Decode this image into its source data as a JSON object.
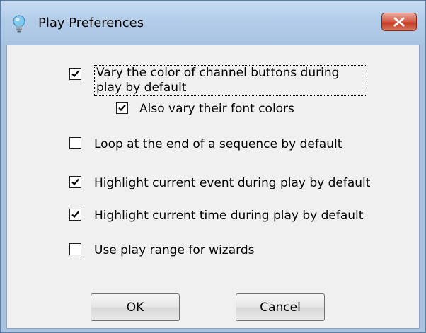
{
  "window": {
    "title": "Play Preferences",
    "close_icon": "close-icon"
  },
  "options": {
    "vary_color": {
      "label_line1": "Vary the color of channel buttons during",
      "label_line2": "play by default",
      "checked": true
    },
    "vary_font": {
      "label": "Also vary their font colors",
      "checked": true
    },
    "loop": {
      "label": "Loop at the end of a sequence by default",
      "checked": false
    },
    "highlight_event": {
      "label": "Highlight current event during play by default",
      "checked": true
    },
    "highlight_time": {
      "label": "Highlight current time during play by default",
      "checked": true
    },
    "play_range": {
      "label": "Use play range for wizards",
      "checked": false
    }
  },
  "buttons": {
    "ok": "OK",
    "cancel": "Cancel"
  }
}
